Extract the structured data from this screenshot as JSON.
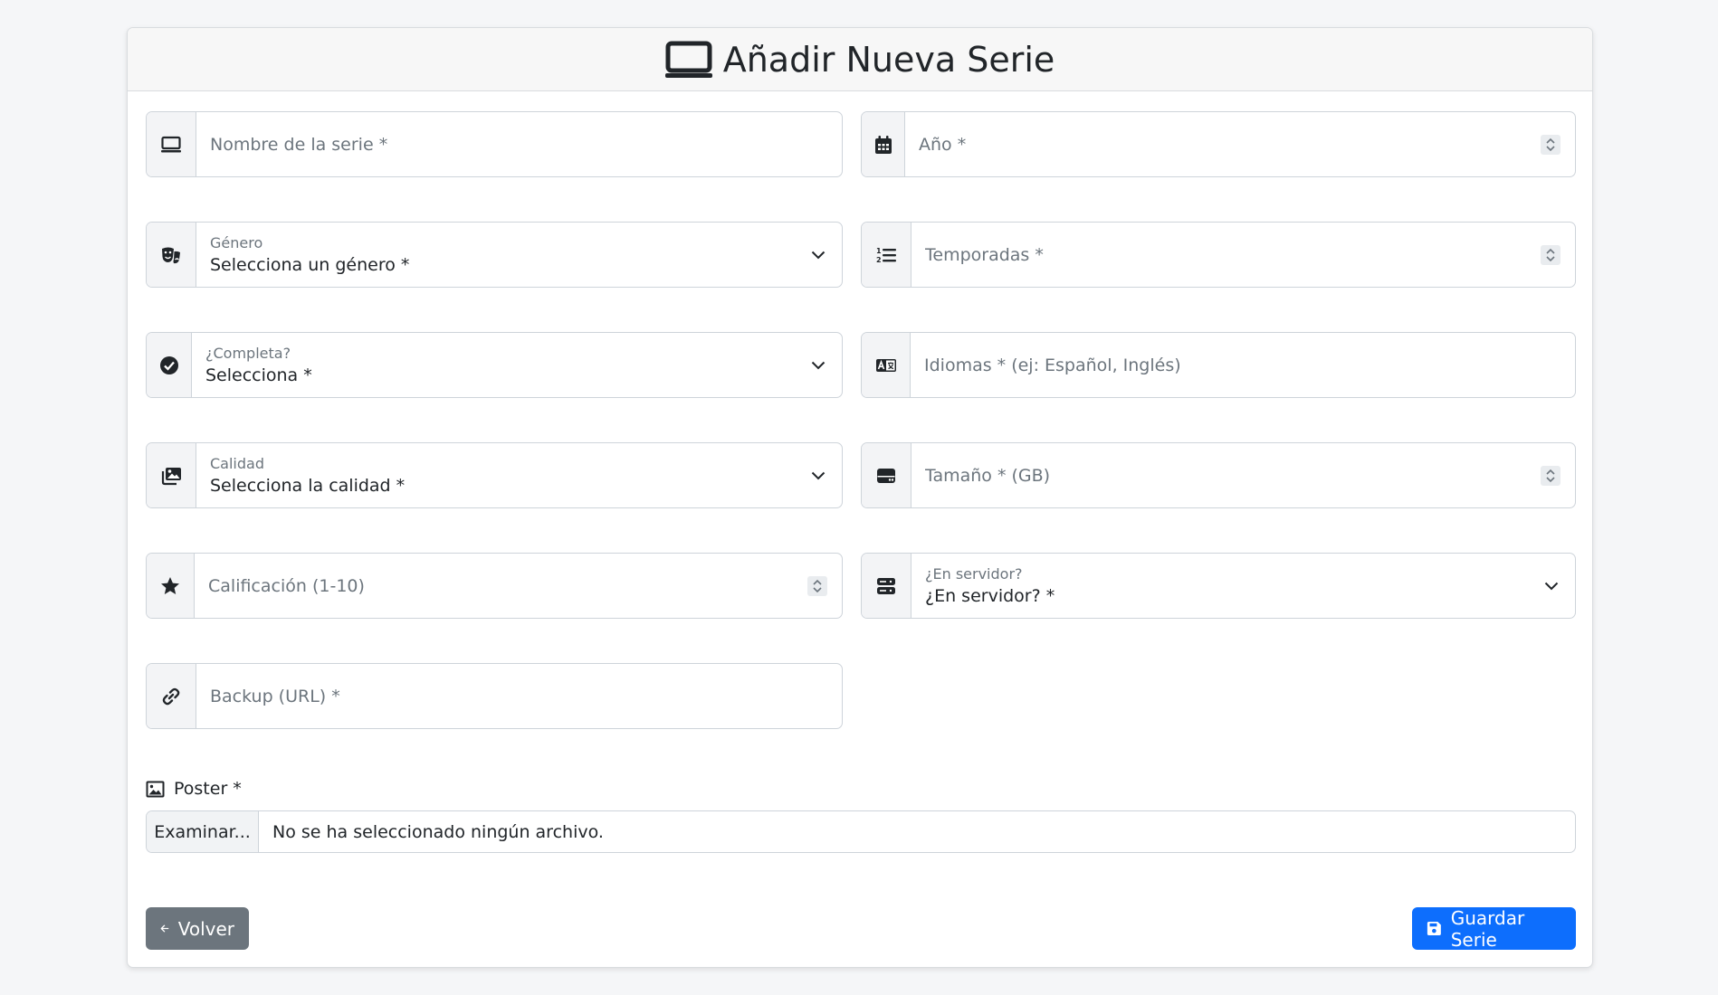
{
  "header": {
    "title": "Añadir Nueva Serie",
    "icon": "tv-icon"
  },
  "form": {
    "nombre": {
      "placeholder": "Nombre de la serie *",
      "icon": "tv-icon"
    },
    "anio": {
      "placeholder": "Año *",
      "icon": "calendar-icon"
    },
    "genero": {
      "label": "Género",
      "value": "Selecciona un género *",
      "icon": "theater-masks-icon"
    },
    "temporadas": {
      "placeholder": "Temporadas *",
      "icon": "list-ol-icon"
    },
    "completa": {
      "label": "¿Completa?",
      "value": "Selecciona *",
      "icon": "check-circle-icon"
    },
    "idiomas": {
      "placeholder": "Idiomas * (ej: Español, Inglés)",
      "icon": "language-icon"
    },
    "calidad": {
      "label": "Calidad",
      "value": "Selecciona la calidad *",
      "icon": "images-icon"
    },
    "tamano": {
      "placeholder": "Tamaño * (GB)",
      "icon": "hdd-icon"
    },
    "calificacion": {
      "placeholder": "Calificación (1-10)",
      "icon": "star-icon"
    },
    "servidor": {
      "label": "¿En servidor?",
      "value": "¿En servidor? *",
      "icon": "server-icon"
    },
    "backup": {
      "placeholder": "Backup (URL) *",
      "icon": "link-icon"
    },
    "poster": {
      "label": "Poster *",
      "icon": "image-icon",
      "button": "Examinar...",
      "status": "No se ha seleccionado ningún archivo."
    }
  },
  "actions": {
    "back_label": "Volver",
    "save_label": "Guardar Serie"
  },
  "colors": {
    "primary": "#0d6efd",
    "secondary": "#6c757d"
  }
}
